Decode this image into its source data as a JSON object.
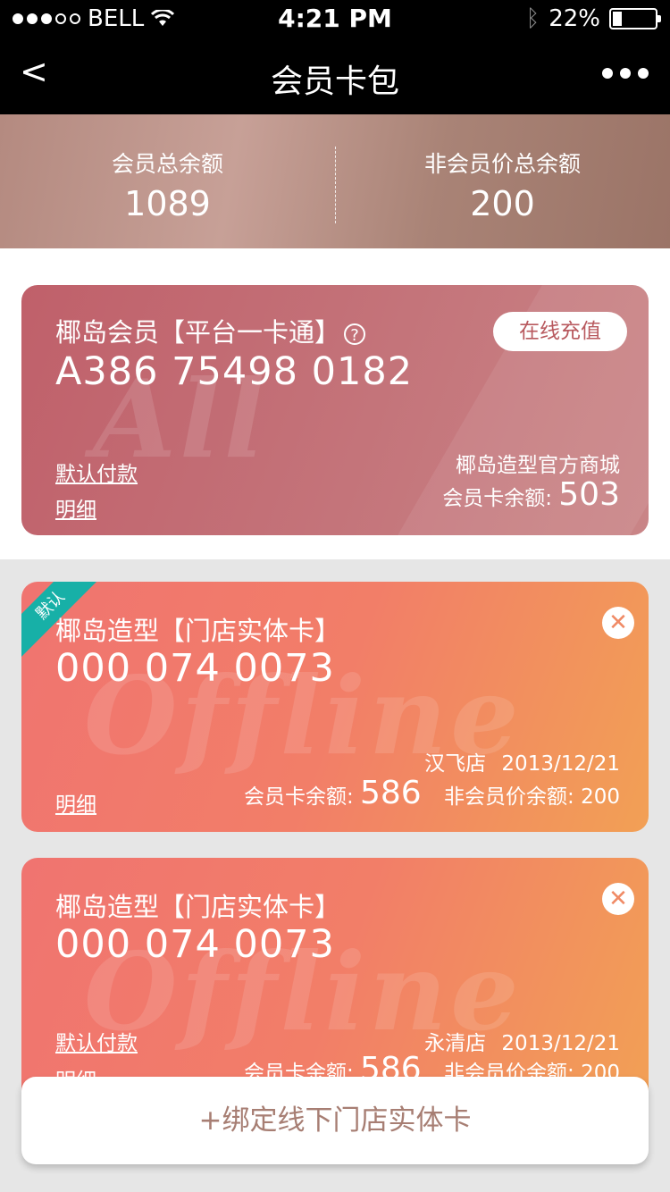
{
  "status": {
    "carrier": "BELL",
    "time": "4:21 PM",
    "battery": "22%"
  },
  "nav": {
    "back": "<",
    "title": "会员卡包"
  },
  "summary": {
    "member_label": "会员总余额",
    "member_value": "1089",
    "nonmember_label": "非会员价总余额",
    "nonmember_value": "200"
  },
  "platform_card": {
    "name": "椰岛会员【平台一卡通】",
    "number": "A386 75498 0182",
    "recharge": "在线充值",
    "default_pay": "默认付款",
    "detail": "明细",
    "store": "椰岛造型官方商城",
    "balance_label": "会员卡余额:",
    "balance": "503",
    "watermark": "All"
  },
  "offline_cards": [
    {
      "badge": "默认",
      "name": "椰岛造型【门店实体卡】",
      "number": "000 074 0073",
      "store": "汉飞店",
      "date": "2013/12/21",
      "detail": "明细",
      "balance_label": "会员卡余额:",
      "balance": "586",
      "nonmember_label": "非会员价余额:",
      "nonmember": "200",
      "watermark": "Offline"
    },
    {
      "name": "椰岛造型【门店实体卡】",
      "number": "000 074 0073",
      "default_pay": "默认付款",
      "store": "永清店",
      "date": "2013/12/21",
      "detail": "明细",
      "balance_label": "会员卡余额:",
      "balance": "586",
      "nonmember_label": "非会员价余额:",
      "nonmember": "200",
      "watermark": "Offline"
    }
  ],
  "bind_button": "+绑定线下门店实体卡",
  "colors": {
    "platform_card": "#c0606a",
    "offline_card": "#f27e68",
    "ribbon": "#17b0a7",
    "summary": "#b48a80"
  }
}
